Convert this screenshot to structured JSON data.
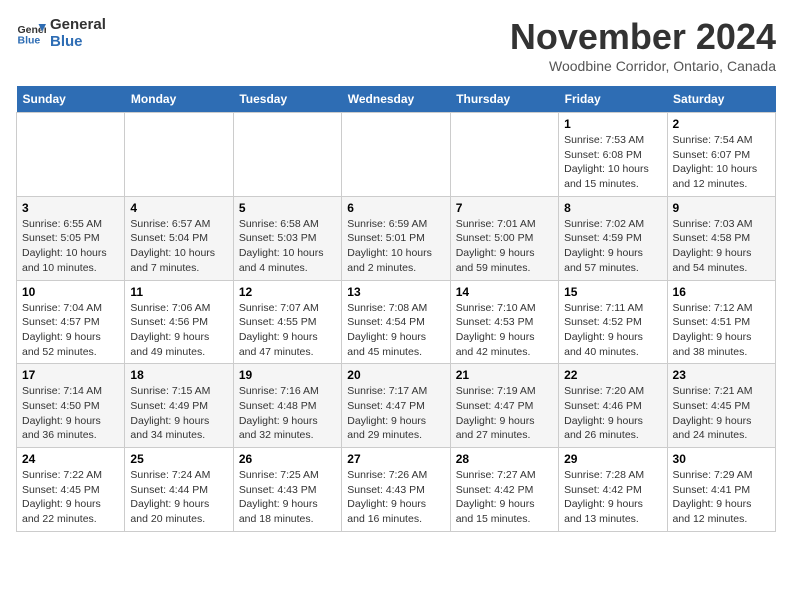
{
  "header": {
    "logo_line1": "General",
    "logo_line2": "Blue",
    "month_title": "November 2024",
    "location": "Woodbine Corridor, Ontario, Canada"
  },
  "weekdays": [
    "Sunday",
    "Monday",
    "Tuesday",
    "Wednesday",
    "Thursday",
    "Friday",
    "Saturday"
  ],
  "weeks": [
    [
      {
        "day": "",
        "info": ""
      },
      {
        "day": "",
        "info": ""
      },
      {
        "day": "",
        "info": ""
      },
      {
        "day": "",
        "info": ""
      },
      {
        "day": "",
        "info": ""
      },
      {
        "day": "1",
        "info": "Sunrise: 7:53 AM\nSunset: 6:08 PM\nDaylight: 10 hours and 15 minutes."
      },
      {
        "day": "2",
        "info": "Sunrise: 7:54 AM\nSunset: 6:07 PM\nDaylight: 10 hours and 12 minutes."
      }
    ],
    [
      {
        "day": "3",
        "info": "Sunrise: 6:55 AM\nSunset: 5:05 PM\nDaylight: 10 hours and 10 minutes."
      },
      {
        "day": "4",
        "info": "Sunrise: 6:57 AM\nSunset: 5:04 PM\nDaylight: 10 hours and 7 minutes."
      },
      {
        "day": "5",
        "info": "Sunrise: 6:58 AM\nSunset: 5:03 PM\nDaylight: 10 hours and 4 minutes."
      },
      {
        "day": "6",
        "info": "Sunrise: 6:59 AM\nSunset: 5:01 PM\nDaylight: 10 hours and 2 minutes."
      },
      {
        "day": "7",
        "info": "Sunrise: 7:01 AM\nSunset: 5:00 PM\nDaylight: 9 hours and 59 minutes."
      },
      {
        "day": "8",
        "info": "Sunrise: 7:02 AM\nSunset: 4:59 PM\nDaylight: 9 hours and 57 minutes."
      },
      {
        "day": "9",
        "info": "Sunrise: 7:03 AM\nSunset: 4:58 PM\nDaylight: 9 hours and 54 minutes."
      }
    ],
    [
      {
        "day": "10",
        "info": "Sunrise: 7:04 AM\nSunset: 4:57 PM\nDaylight: 9 hours and 52 minutes."
      },
      {
        "day": "11",
        "info": "Sunrise: 7:06 AM\nSunset: 4:56 PM\nDaylight: 9 hours and 49 minutes."
      },
      {
        "day": "12",
        "info": "Sunrise: 7:07 AM\nSunset: 4:55 PM\nDaylight: 9 hours and 47 minutes."
      },
      {
        "day": "13",
        "info": "Sunrise: 7:08 AM\nSunset: 4:54 PM\nDaylight: 9 hours and 45 minutes."
      },
      {
        "day": "14",
        "info": "Sunrise: 7:10 AM\nSunset: 4:53 PM\nDaylight: 9 hours and 42 minutes."
      },
      {
        "day": "15",
        "info": "Sunrise: 7:11 AM\nSunset: 4:52 PM\nDaylight: 9 hours and 40 minutes."
      },
      {
        "day": "16",
        "info": "Sunrise: 7:12 AM\nSunset: 4:51 PM\nDaylight: 9 hours and 38 minutes."
      }
    ],
    [
      {
        "day": "17",
        "info": "Sunrise: 7:14 AM\nSunset: 4:50 PM\nDaylight: 9 hours and 36 minutes."
      },
      {
        "day": "18",
        "info": "Sunrise: 7:15 AM\nSunset: 4:49 PM\nDaylight: 9 hours and 34 minutes."
      },
      {
        "day": "19",
        "info": "Sunrise: 7:16 AM\nSunset: 4:48 PM\nDaylight: 9 hours and 32 minutes."
      },
      {
        "day": "20",
        "info": "Sunrise: 7:17 AM\nSunset: 4:47 PM\nDaylight: 9 hours and 29 minutes."
      },
      {
        "day": "21",
        "info": "Sunrise: 7:19 AM\nSunset: 4:47 PM\nDaylight: 9 hours and 27 minutes."
      },
      {
        "day": "22",
        "info": "Sunrise: 7:20 AM\nSunset: 4:46 PM\nDaylight: 9 hours and 26 minutes."
      },
      {
        "day": "23",
        "info": "Sunrise: 7:21 AM\nSunset: 4:45 PM\nDaylight: 9 hours and 24 minutes."
      }
    ],
    [
      {
        "day": "24",
        "info": "Sunrise: 7:22 AM\nSunset: 4:45 PM\nDaylight: 9 hours and 22 minutes."
      },
      {
        "day": "25",
        "info": "Sunrise: 7:24 AM\nSunset: 4:44 PM\nDaylight: 9 hours and 20 minutes."
      },
      {
        "day": "26",
        "info": "Sunrise: 7:25 AM\nSunset: 4:43 PM\nDaylight: 9 hours and 18 minutes."
      },
      {
        "day": "27",
        "info": "Sunrise: 7:26 AM\nSunset: 4:43 PM\nDaylight: 9 hours and 16 minutes."
      },
      {
        "day": "28",
        "info": "Sunrise: 7:27 AM\nSunset: 4:42 PM\nDaylight: 9 hours and 15 minutes."
      },
      {
        "day": "29",
        "info": "Sunrise: 7:28 AM\nSunset: 4:42 PM\nDaylight: 9 hours and 13 minutes."
      },
      {
        "day": "30",
        "info": "Sunrise: 7:29 AM\nSunset: 4:41 PM\nDaylight: 9 hours and 12 minutes."
      }
    ]
  ]
}
